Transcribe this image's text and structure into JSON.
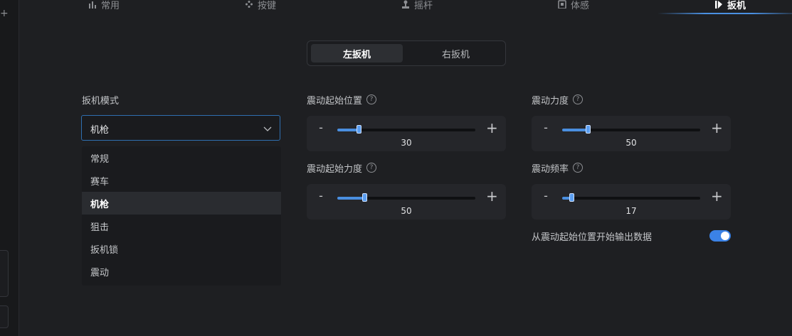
{
  "nav": {
    "tabs": [
      {
        "label": "常用",
        "icon": "bar-chart-icon"
      },
      {
        "label": "按键",
        "icon": "gamepad-icon"
      },
      {
        "label": "摇杆",
        "icon": "joystick-icon"
      },
      {
        "label": "体感",
        "icon": "motion-icon"
      },
      {
        "label": "扳机",
        "icon": "trigger-icon"
      }
    ],
    "active_index": 4
  },
  "segment": {
    "left_label": "左扳机",
    "right_label": "右扳机",
    "active": "left"
  },
  "trigger_mode": {
    "label": "扳机模式",
    "selected": "机枪",
    "options": [
      "常规",
      "赛车",
      "机枪",
      "狙击",
      "扳机锁",
      "震动"
    ]
  },
  "sliders": {
    "start_position": {
      "label": "震动起始位置",
      "value": 30,
      "fraction": 0.16
    },
    "strength": {
      "label": "震动力度",
      "value": 50,
      "fraction": 0.19
    },
    "start_strength": {
      "label": "震动起始力度",
      "value": 50,
      "fraction": 0.2
    },
    "frequency": {
      "label": "震动频率",
      "value": 17,
      "fraction": 0.07
    }
  },
  "button_symbols": {
    "minus": "-",
    "plus": "+",
    "help": "?"
  },
  "output_toggle": {
    "label": "从震动起始位置开始输出数据",
    "on": true
  },
  "colors": {
    "accent": "#4a8fe0",
    "background": "#1e1f22",
    "card": "#25262a"
  }
}
